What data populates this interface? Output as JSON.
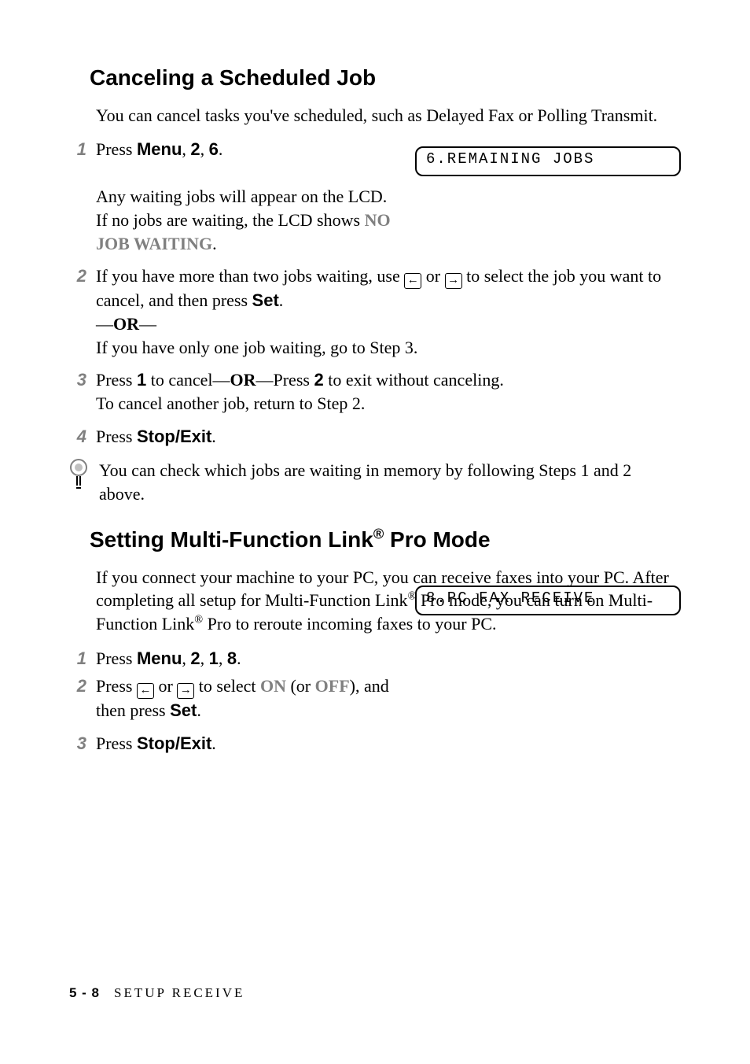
{
  "section1": {
    "heading": "Canceling a Scheduled Job",
    "intro": "You can cancel tasks you've scheduled, such as Delayed Fax or Polling Transmit.",
    "step1_prefix": "Press ",
    "step1_menu": "Menu",
    "step1_sep1": ", ",
    "step1_k1": "2",
    "step1_sep2": ", ",
    "step1_k2": "6",
    "step1_suffix": ".",
    "step1_note_a": "Any waiting jobs will appear on the LCD. If no jobs are waiting, the LCD shows ",
    "step1_note_b": "NO JOB WAITING",
    "step1_note_c": ".",
    "step2_a": "If you have more than two jobs waiting, use ",
    "step2_b": " or ",
    "step2_c": " to select the job you want to cancel, and then press ",
    "step2_set": "Set",
    "step2_d": ".",
    "step2_or_dash1": "—",
    "step2_or": "OR",
    "step2_or_dash2": "—",
    "step2_e": "If you have only one job waiting, go to Step 3.",
    "step3_a": "Press ",
    "step3_k1": "1",
    "step3_b": " to cancel—",
    "step3_or": "OR",
    "step3_c": "—Press ",
    "step3_k2": "2",
    "step3_d": " to exit without canceling.",
    "step3_e": "To cancel another job, return to Step 2.",
    "step4_a": "Press ",
    "step4_stop": "Stop/Exit",
    "step4_b": ".",
    "tip": "You can check which jobs are waiting in memory by following Steps 1 and 2 above.",
    "lcd": "6.REMAINING JOBS"
  },
  "section2": {
    "heading_a": "Setting Multi-Function Link",
    "heading_sup": "®",
    "heading_b": " Pro Mode",
    "intro_a": "If you connect your machine to your PC, you can receive faxes into your PC. After completing all setup for Multi-Function Link",
    "intro_b": " Pro mode,  you can turn on Multi-Function Link",
    "intro_c": " Pro to reroute incoming faxes to your PC.",
    "step1_prefix": "Press ",
    "step1_menu": "Menu",
    "step1_sep1": ", ",
    "step1_k1": "2",
    "step1_sep2": ", ",
    "step1_k2": "1",
    "step1_sep3": ", ",
    "step1_k3": "8",
    "step1_suffix": ".",
    "step2_a": "Press ",
    "step2_b": " or ",
    "step2_c": " to select ",
    "step2_on": "ON",
    "step2_d": " (or ",
    "step2_off": "OFF",
    "step2_e": "), and then press ",
    "step2_set": "Set",
    "step2_f": ".",
    "step3_a": "Press ",
    "step3_stop": "Stop/Exit",
    "step3_b": ".",
    "lcd": "8.PC FAX RECEIVE"
  },
  "nums": {
    "n1": "1",
    "n2": "2",
    "n3": "3",
    "n4": "4"
  },
  "arrows": {
    "left": "←",
    "right": "→"
  },
  "footer": {
    "page": "5 - 8",
    "chapter": "SETUP RECEIVE"
  }
}
